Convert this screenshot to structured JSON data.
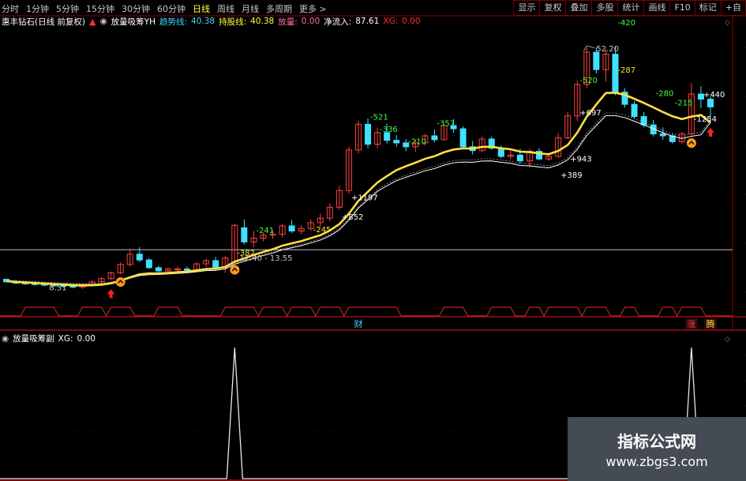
{
  "toolbar": {
    "periods": [
      "分时",
      "1分钟",
      "5分钟",
      "15分钟",
      "30分钟",
      "60分钟",
      "日线",
      "周线",
      "月线",
      "多周期",
      "更多 >"
    ],
    "active_period": "日线",
    "buttons": [
      "显示",
      "复权",
      "叠加",
      "多股",
      "统计",
      "画线",
      "F10",
      "标记",
      "+自"
    ]
  },
  "main_legend": {
    "stock": "惠丰钻石(日线 前复权)",
    "indicator": "放量吸筹YH",
    "trend_label": "趋势线:",
    "trend_value": "40.38",
    "hold_label": "持股线:",
    "hold_value": "40.38",
    "vol_label": "放量:",
    "vol_value": "0.00",
    "inflow_label": "净流入:",
    "inflow_value": "87.61",
    "xg_label": "XG:",
    "xg_value": "0.00"
  },
  "sub_legend": {
    "indicator": "放量吸筹副",
    "xg_label": "XG:",
    "xg_value": "0.00"
  },
  "chart_data": {
    "type": "candlestick",
    "colors": {
      "up": "#ff4040",
      "down": "#40e0ff",
      "trend": "#ffe040",
      "hold": "#ffffff",
      "background": "#000000",
      "grid": "#8b0000"
    },
    "candles": [
      [
        16.0,
        16.1,
        15.5,
        15.6
      ],
      [
        15.6,
        15.9,
        15.3,
        15.4
      ],
      [
        15.4,
        15.7,
        15.1,
        15.3
      ],
      [
        15.3,
        15.6,
        15.0,
        15.2
      ],
      [
        15.2,
        15.5,
        14.9,
        15.1
      ],
      [
        15.1,
        15.4,
        14.8,
        15.0
      ],
      [
        15.0,
        15.3,
        14.7,
        14.9
      ],
      [
        14.9,
        15.2,
        14.6,
        14.8
      ],
      [
        14.8,
        15.4,
        14.5,
        15.2
      ],
      [
        15.2,
        15.8,
        15.0,
        15.6
      ],
      [
        15.6,
        16.3,
        15.4,
        16.1
      ],
      [
        16.1,
        17.2,
        15.9,
        17.0
      ],
      [
        17.0,
        18.6,
        16.8,
        18.3
      ],
      [
        18.3,
        20.8,
        18.0,
        19.9
      ],
      [
        19.9,
        21.0,
        18.7,
        19.0
      ],
      [
        19.0,
        19.3,
        17.6,
        17.8
      ],
      [
        17.8,
        18.1,
        17.0,
        17.3
      ],
      [
        17.3,
        17.8,
        16.9,
        17.6
      ],
      [
        17.6,
        18.0,
        17.2,
        17.6
      ],
      [
        17.6,
        18.0,
        17.2,
        17.4
      ],
      [
        17.4,
        18.6,
        17.1,
        18.4
      ],
      [
        18.4,
        19.2,
        17.9,
        18.9
      ],
      [
        18.9,
        19.5,
        17.4,
        17.8
      ],
      [
        17.8,
        19.6,
        17.0,
        19.3
      ],
      [
        18.7,
        24.6,
        18.7,
        24.4
      ],
      [
        24.0,
        25.3,
        21.4,
        21.8
      ],
      [
        21.8,
        23.5,
        21.0,
        22.4
      ],
      [
        22.4,
        23.2,
        21.9,
        22.9
      ],
      [
        22.9,
        23.7,
        22.3,
        23.0
      ],
      [
        23.0,
        24.6,
        22.5,
        24.3
      ],
      [
        24.3,
        25.2,
        23.2,
        23.5
      ],
      [
        23.5,
        24.4,
        23.0,
        23.9
      ],
      [
        23.9,
        25.3,
        23.5,
        24.8
      ],
      [
        24.8,
        26.2,
        24.2,
        25.5
      ],
      [
        25.5,
        27.8,
        25.0,
        27.2
      ],
      [
        27.2,
        30.5,
        26.8,
        29.8
      ],
      [
        29.8,
        36.6,
        29.3,
        36.1
      ],
      [
        36.1,
        40.7,
        35.6,
        40.1
      ],
      [
        40.1,
        41.0,
        36.4,
        37.0
      ],
      [
        37.0,
        39.6,
        36.4,
        38.8
      ],
      [
        38.8,
        40.2,
        37.1,
        37.6
      ],
      [
        37.6,
        38.4,
        36.6,
        37.2
      ],
      [
        37.2,
        37.8,
        35.9,
        36.6
      ],
      [
        36.6,
        37.7,
        35.8,
        37.2
      ],
      [
        37.2,
        38.6,
        36.8,
        38.3
      ],
      [
        38.3,
        39.3,
        37.3,
        37.7
      ],
      [
        37.7,
        40.2,
        37.6,
        39.9
      ],
      [
        39.9,
        40.9,
        38.8,
        39.4
      ],
      [
        39.4,
        39.8,
        36.4,
        36.6
      ],
      [
        36.6,
        37.5,
        35.4,
        36.0
      ],
      [
        36.0,
        38.2,
        35.8,
        37.8
      ],
      [
        37.8,
        38.2,
        36.1,
        36.4
      ],
      [
        36.4,
        36.8,
        34.8,
        35.1
      ],
      [
        35.1,
        36.0,
        34.7,
        35.3
      ],
      [
        35.3,
        36.3,
        34.0,
        34.4
      ],
      [
        34.4,
        36.3,
        33.4,
        35.9
      ],
      [
        35.9,
        36.4,
        34.5,
        34.7
      ],
      [
        34.7,
        35.6,
        34.4,
        35.1
      ],
      [
        35.1,
        38.7,
        34.9,
        38.0
      ],
      [
        38.0,
        42.0,
        37.8,
        41.4
      ],
      [
        41.4,
        46.9,
        40.6,
        46.3
      ],
      [
        46.3,
        52.0,
        45.7,
        51.3
      ],
      [
        51.3,
        52.0,
        48.0,
        48.6
      ],
      [
        48.6,
        51.8,
        46.7,
        51.0
      ],
      [
        51.0,
        52.2,
        44.6,
        45.1
      ],
      [
        45.1,
        45.7,
        42.7,
        43.2
      ],
      [
        43.2,
        43.7,
        41.0,
        41.3
      ],
      [
        41.3,
        42.0,
        39.6,
        40.0
      ],
      [
        40.0,
        40.8,
        38.2,
        38.6
      ],
      [
        38.6,
        39.6,
        37.7,
        38.3
      ],
      [
        38.3,
        38.7,
        37.1,
        37.4
      ],
      [
        37.4,
        38.9,
        37.1,
        38.6
      ],
      [
        38.6,
        46.5,
        38.4,
        44.8
      ],
      [
        44.8,
        46.0,
        42.6,
        44.0
      ],
      [
        44.0,
        44.4,
        41.0,
        42.8
      ]
    ],
    "trend_line": [
      15.7,
      15.57,
      15.49,
      15.41,
      15.32,
      15.24,
      15.15,
      15.07,
      15.03,
      15.06,
      15.15,
      15.37,
      15.76,
      16.3,
      16.76,
      16.9,
      16.9,
      16.97,
      17.09,
      17.18,
      17.37,
      17.58,
      17.65,
      17.91,
      18.73,
      19.24,
      19.79,
      20.24,
      20.66,
      21.22,
      21.58,
      21.93,
      22.39,
      22.85,
      23.58,
      24.58,
      26.2,
      28.19,
      29.6,
      31.04,
      32.04,
      32.97,
      33.58,
      34.13,
      34.73,
      35.13,
      35.75,
      36.17,
      36.35,
      36.33,
      36.58,
      36.6,
      36.38,
      36.21,
      35.84,
      35.77,
      35.57,
      35.44,
      35.95,
      36.88,
      38.79,
      41.3,
      43.17,
      44.96,
      45.01,
      44.68,
      44.06,
      43.42,
      42.72,
      42.0,
      41.35,
      40.91,
      41.29,
      41.54,
      40.38
    ],
    "hold_line": [
      15.7,
      15.62,
      15.55,
      15.48,
      15.41,
      15.34,
      15.27,
      15.2,
      15.17,
      15.19,
      15.25,
      15.4,
      15.71,
      16.17,
      16.58,
      16.71,
      16.74,
      16.82,
      16.92,
      17.0,
      17.16,
      17.34,
      17.39,
      17.61,
      18.34,
      18.78,
      19.27,
      19.69,
      20.07,
      20.57,
      20.9,
      21.23,
      21.65,
      22.08,
      22.76,
      23.69,
      25.2,
      27.06,
      28.36,
      29.66,
      30.53,
      31.33,
      31.87,
      32.35,
      32.87,
      33.21,
      33.74,
      34.1,
      34.23,
      34.19,
      34.39,
      34.4,
      34.19,
      34.03,
      33.7,
      33.63,
      33.45,
      33.33,
      33.77,
      34.58,
      36.22,
      38.35,
      39.91,
      41.44,
      41.45,
      41.13,
      40.57,
      40.01,
      39.4,
      38.79,
      38.24,
      37.88,
      38.24,
      38.46,
      40.38
    ],
    "price_annotations": [
      {
        "text": "52.20",
        "index": 61,
        "price": 52.2
      },
      {
        "text": "12.40 - 13.55",
        "index": 24,
        "price": 20.6
      },
      {
        "text": "8.51",
        "index": 4,
        "price": 15.0
      }
    ],
    "flow_labels": [
      {
        "text": "-382",
        "index": 24,
        "price": 20.2,
        "color": "#ffe040"
      },
      {
        "text": "-241",
        "index": 26,
        "price": 23.7,
        "color": "#40ff40"
      },
      {
        "text": "-245",
        "index": 32,
        "price": 23.8,
        "color": "#ffe040"
      },
      {
        "text": "+852",
        "index": 35,
        "price": 25.8,
        "color": "#ffffff"
      },
      {
        "text": "+1197",
        "index": 36,
        "price": 28.8,
        "color": "#ffffff"
      },
      {
        "text": "-521",
        "index": 38,
        "price": 41.3,
        "color": "#40ff40"
      },
      {
        "text": "-336",
        "index": 39,
        "price": 39.4,
        "color": "#40ff40"
      },
      {
        "text": "-210",
        "index": 42,
        "price": 37.5,
        "color": "#40ff40"
      },
      {
        "text": "-357",
        "index": 45,
        "price": 40.3,
        "color": "#40ff40"
      },
      {
        "text": "+389",
        "index": 58,
        "price": 32.3,
        "color": "#ffffff"
      },
      {
        "text": "+943",
        "index": 59,
        "price": 34.8,
        "color": "#ffffff"
      },
      {
        "text": "+697",
        "index": 60,
        "price": 42.0,
        "color": "#ffffff"
      },
      {
        "text": "-520",
        "index": 60,
        "price": 47.0,
        "color": "#40ff40"
      },
      {
        "text": "-420",
        "index": 64,
        "price": 56.0,
        "color": "#40ff40"
      },
      {
        "text": "-287",
        "index": 64,
        "price": 48.6,
        "color": "#ffe040"
      },
      {
        "text": "-280",
        "index": 68,
        "price": 45.0,
        "color": "#40ff40"
      },
      {
        "text": "-215",
        "index": 70,
        "price": 43.5,
        "color": "#40ff40"
      },
      {
        "text": "-1254",
        "index": 72,
        "price": 41.0,
        "color": "#ffffff"
      },
      {
        "text": "+440",
        "index": 73,
        "price": 44.8,
        "color": "#ffffff"
      }
    ],
    "buy_signals": [
      12,
      24,
      72
    ],
    "up_arrows": [
      11,
      74
    ],
    "band_markers": [
      {
        "text": "财",
        "index": 37,
        "color": "#40d8ff"
      },
      {
        "text": "涨",
        "index": 72,
        "color": "#ff4040"
      },
      {
        "text": "腾",
        "index": 74,
        "color": "#ffe040"
      }
    ],
    "xg_spikes": [
      24,
      72
    ]
  },
  "watermark": {
    "line1": "指标公式网",
    "line2": "www.zbgs3.com"
  }
}
